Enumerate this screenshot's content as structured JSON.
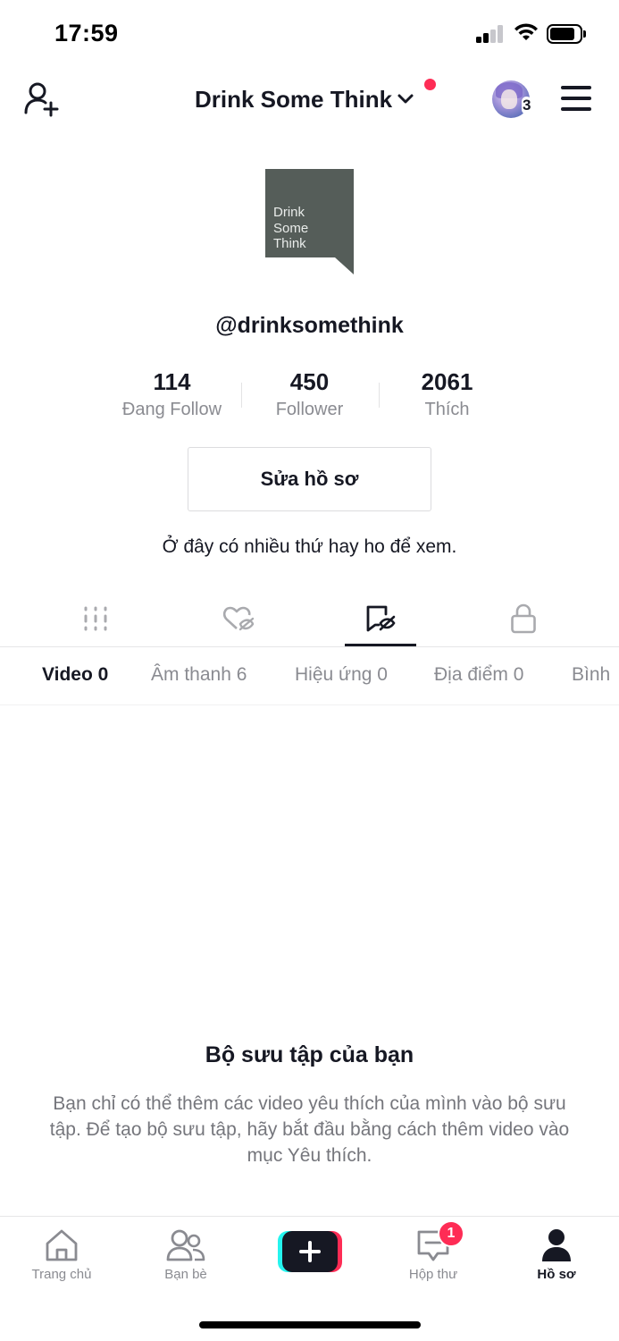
{
  "status_bar": {
    "time": "17:59",
    "icons": [
      "signal-icon",
      "wifi-icon",
      "battery-icon"
    ]
  },
  "header": {
    "account_name": "Drink Some Think",
    "story_count": "3",
    "icons": [
      "add-user-icon",
      "chevron-down-icon",
      "hamburger-menu-icon"
    ],
    "notification_dot_color": "#fe2c55"
  },
  "profile": {
    "logo_text": "Drink Some Think",
    "logo_lines": [
      "Drink",
      "Some",
      "Think"
    ],
    "logo_color": "#555d59",
    "handle": "@drinksomethink",
    "stats": [
      {
        "value": "114",
        "label": "Đang Follow"
      },
      {
        "value": "450",
        "label": "Follower"
      },
      {
        "value": "2061",
        "label": "Thích"
      }
    ],
    "edit_button": "Sửa hồ sơ",
    "bio": "Ở đây có nhiều thứ hay ho để xem."
  },
  "icon_tabs": [
    {
      "icon": "videos-grid-icon",
      "active": false
    },
    {
      "icon": "liked-hidden-icon",
      "active": false
    },
    {
      "icon": "favorites-hidden-icon",
      "active": true
    },
    {
      "icon": "lock-icon",
      "active": false
    }
  ],
  "sub_tabs": [
    {
      "label": "Video 0",
      "active": true
    },
    {
      "label": "Âm thanh 6",
      "active": false
    },
    {
      "label": "Hiệu ứng 0",
      "active": false
    },
    {
      "label": "Địa điểm 0",
      "active": false
    },
    {
      "label": "Bình",
      "active": false
    }
  ],
  "empty_state": {
    "title": "Bộ sưu tập của bạn",
    "description": "Bạn chỉ có thể thêm các video yêu thích của mình vào bộ sưu tập. Để tạo bộ sưu tập, hãy bắt đầu bằng cách thêm video vào mục Yêu thích."
  },
  "bottom_nav": {
    "items": [
      {
        "label": "Trang chủ",
        "icon": "home-icon",
        "active": false
      },
      {
        "label": "Bạn bè",
        "icon": "friends-icon",
        "active": false
      },
      {
        "label": "",
        "icon": "create-plus-icon",
        "active": false
      },
      {
        "label": "Hộp thư",
        "icon": "inbox-icon",
        "active": false
      },
      {
        "label": "Hồ sơ",
        "icon": "profile-icon",
        "active": true
      }
    ],
    "inbox_badge": "1"
  },
  "colors": {
    "text_primary": "#161823",
    "text_secondary": "#8a8b91",
    "accent_red": "#fe2c55",
    "accent_cyan": "#25f4ee"
  }
}
